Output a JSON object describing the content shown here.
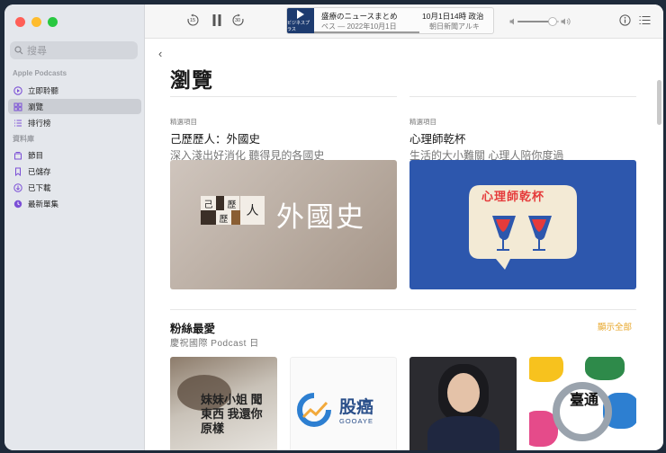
{
  "sidebar": {
    "search_placeholder": "搜尋",
    "section1_label": "Apple Podcasts",
    "section1_items": [
      {
        "label": "立即聆聽",
        "icon": "play-circle-icon"
      },
      {
        "label": "瀏覽",
        "icon": "grid-icon",
        "active": true
      },
      {
        "label": "排行榜",
        "icon": "list-icon"
      }
    ],
    "section2_label": "資料庫",
    "section2_items": [
      {
        "label": "節目",
        "icon": "stack-icon"
      },
      {
        "label": "已儲存",
        "icon": "bookmark-icon"
      },
      {
        "label": "已下載",
        "icon": "download-icon"
      },
      {
        "label": "最新單集",
        "icon": "clock-icon"
      }
    ]
  },
  "player": {
    "skip_back_label": "15",
    "skip_forward_label": "30",
    "art_label": "ビジネスプラス",
    "title_left": "盛療のニュースまとめ",
    "subtitle_left": "ペス — 2022年10月1日",
    "title_right": "10月1日14時 政治",
    "subtitle_right": "朝日新聞アルキ",
    "progress_fraction": 0.51,
    "volume_fraction": 0.85
  },
  "main": {
    "back_label": "‹",
    "page_title": "瀏覽",
    "featured": [
      {
        "eyebrow": "精選項目",
        "title": "己歷歷人：外國史",
        "subtitle": "深入淺出好消化 聽得見的各國史",
        "art_text": "外國史",
        "art_boxes": [
          "己",
          "歷",
          "歷",
          "人"
        ]
      },
      {
        "eyebrow": "精選項目",
        "title": "心理師乾杯",
        "subtitle": "生活的大小難關 心理人陪你度過",
        "art_text": "心理師乾杯"
      }
    ],
    "section_title": "粉絲最愛",
    "section_subtitle": "慶祝國際 Podcast 日",
    "see_all_label": "顯示全部",
    "tiles": [
      {
        "name": "cat-tile",
        "text": "妹妹小姐 聞東西 我還你原樣"
      },
      {
        "name": "gooaye-tile",
        "text": "股癌",
        "sub": "GOOAYE"
      },
      {
        "name": "portrait-tile",
        "text": ""
      },
      {
        "name": "taiwan-tile",
        "text": "臺通"
      }
    ]
  },
  "colors": {
    "accent": "#e7a526",
    "sidebar_bg": "#e4e7ec",
    "feature_blue": "#2d57ad"
  }
}
